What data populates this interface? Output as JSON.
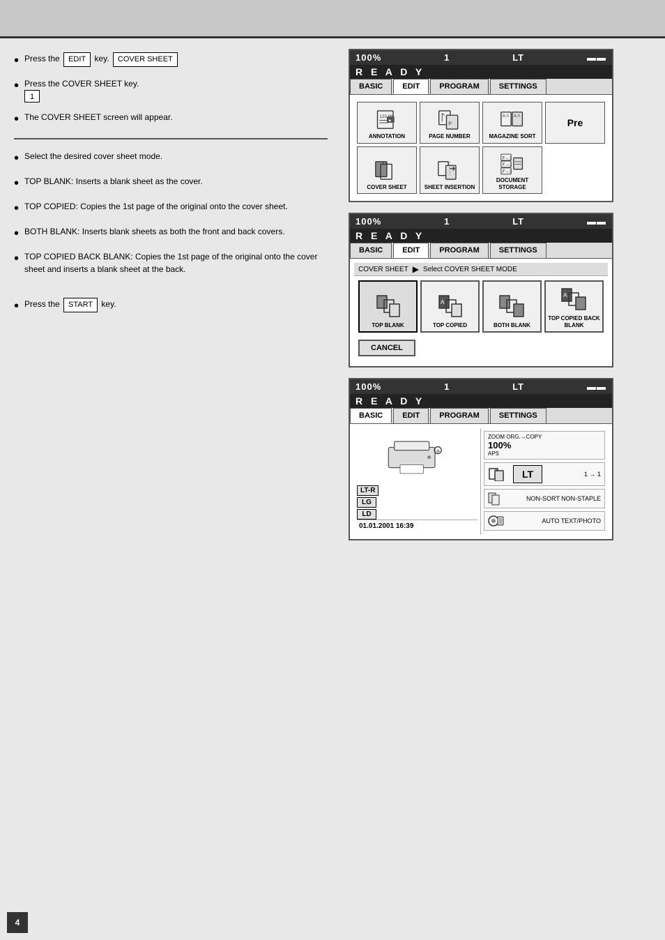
{
  "page": {
    "background": "#e8e8e8"
  },
  "screen1": {
    "header": {
      "zoom": "100%",
      "copies": "1",
      "paper": "LT",
      "paper_icon": "■■"
    },
    "ready_text": "R E A D Y",
    "tabs": [
      "BASIC",
      "EDIT",
      "PROGRAM",
      "SETTINGS"
    ],
    "active_tab": "EDIT",
    "functions": [
      {
        "id": "annotation",
        "label": "ANNOTATION"
      },
      {
        "id": "page-number",
        "label": "PAGE NUMBER"
      },
      {
        "id": "magazine-sort",
        "label": "MAGAZINE SORT"
      },
      {
        "id": "pre",
        "label": "Pre"
      },
      {
        "id": "cover-sheet",
        "label": "COVER SHEET"
      },
      {
        "id": "sheet-insertion",
        "label": "SHEET INSERTION"
      },
      {
        "id": "document-storage",
        "label": "DOCUMENT STORAGE"
      }
    ]
  },
  "screen2": {
    "header": {
      "zoom": "100%",
      "copies": "1",
      "paper": "LT",
      "paper_icon": "■■"
    },
    "ready_text": "R E A D Y",
    "tabs": [
      "BASIC",
      "EDIT",
      "PROGRAM",
      "SETTINGS"
    ],
    "active_tab": "EDIT",
    "mode_label": "COVER SHEET",
    "mode_instruction": "Select COVER SHEET MODE",
    "options": [
      {
        "id": "top-blank",
        "label": "TOP BLANK"
      },
      {
        "id": "top-copied",
        "label": "TOP COPIED"
      },
      {
        "id": "both-blank",
        "label": "BOTH BLANK"
      },
      {
        "id": "top-copied-back-blank",
        "label": "TOP COPIED BACK BLANK"
      }
    ],
    "cancel_label": "CANCEL"
  },
  "screen3": {
    "header": {
      "zoom": "100%",
      "copies": "1",
      "paper": "LT",
      "paper_icon": "■■"
    },
    "ready_text": "R E A D Y",
    "tabs": [
      "BASIC",
      "EDIT",
      "PROGRAM",
      "SETTINGS"
    ],
    "active_tab": "BASIC",
    "paper_sizes": [
      "LT-R",
      "LG",
      "LD"
    ],
    "selected_paper": "LT",
    "date": "01.01.2001 16:39",
    "zoom_label": "ZOOM",
    "zoom_org": "ORG.→COPY",
    "zoom_value": "100%",
    "zoom_aps": "APS",
    "duplex_label": "1 → 1",
    "sort_label": "NON-SORT NON-STAPLE",
    "image_label": "AUTO TEXT/PHOTO"
  },
  "left_text": {
    "section1": {
      "bullet1_text": "Press the EDIT key.",
      "bullet1_box1": "EDIT",
      "bullet1_box2": "COVER SHEET",
      "bullet2_text": "Press the COVER SHEET key.",
      "bullet2_box": "1",
      "bullet3_text": "The COVER SHEET screen will appear."
    },
    "section2": {
      "bullet1_text": "Select the desired cover sheet mode.",
      "bullet2_text": "TOP BLANK: Inserts a blank sheet as the cover.",
      "bullet3_text": "TOP COPIED: Copies the 1st page of the original onto the cover sheet.",
      "bullet4_text": "BOTH BLANK: Inserts blank sheets as both the front and back covers.",
      "bullet5_text": "TOP COPIED BACK BLANK: Copies the 1st page of the original onto the cover sheet and inserts a blank sheet at the back.",
      "bullet6_text": "Press the START key.",
      "start_box": "START"
    }
  },
  "page_number": "4"
}
